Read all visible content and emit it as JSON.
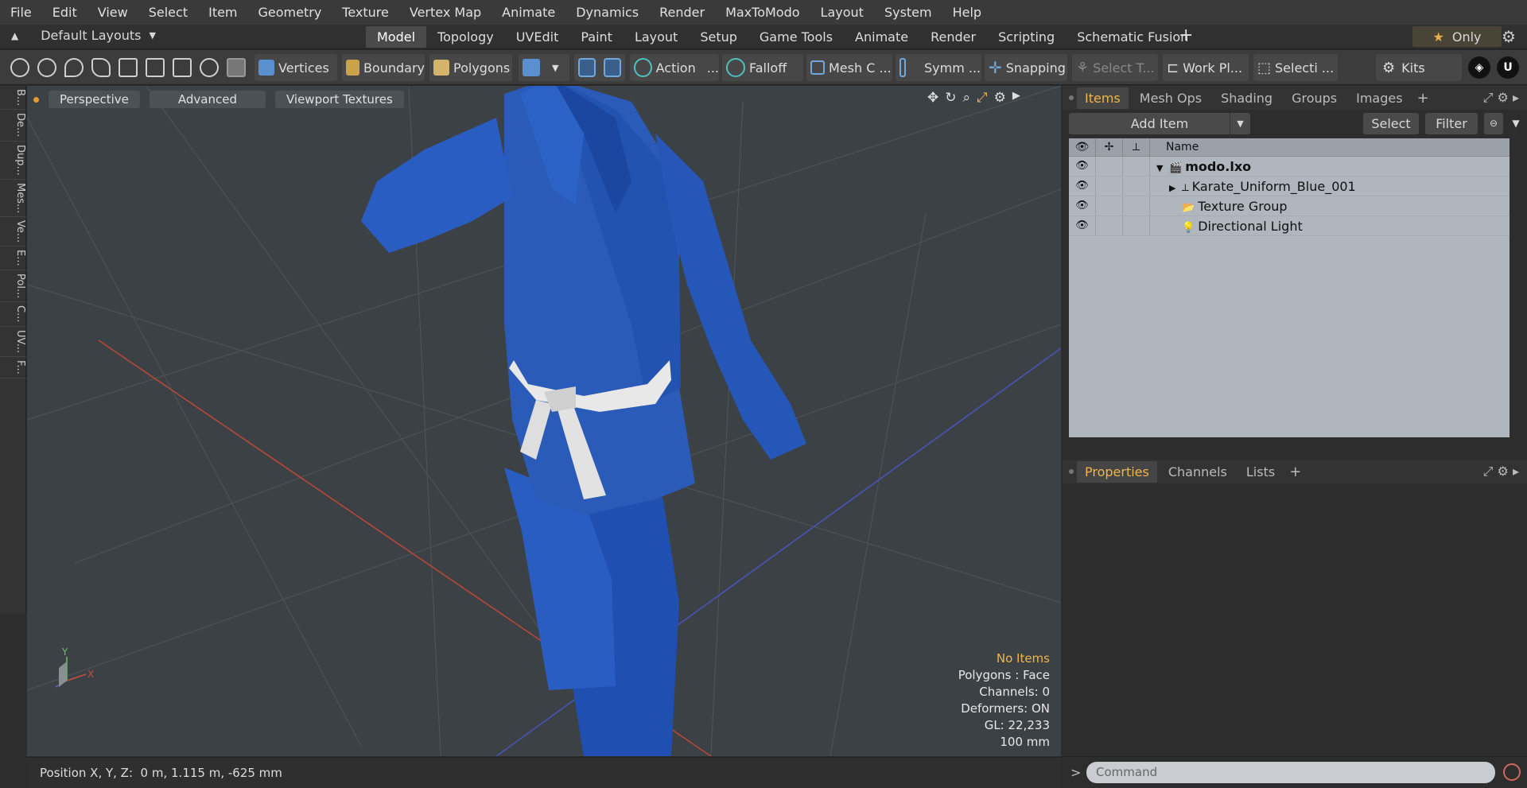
{
  "menu": [
    "File",
    "Edit",
    "View",
    "Select",
    "Item",
    "Geometry",
    "Texture",
    "Vertex Map",
    "Animate",
    "Dynamics",
    "Render",
    "MaxToModo",
    "Layout",
    "System",
    "Help"
  ],
  "layout_selector": "Default Layouts",
  "tabs": [
    "Model",
    "Topology",
    "UVEdit",
    "Paint",
    "Layout",
    "Setup",
    "Game Tools",
    "Animate",
    "Render",
    "Scripting",
    "Schematic Fusion"
  ],
  "active_tab": "Model",
  "only_label": "Only",
  "toolbar": {
    "vertices": "Vertices",
    "boundary": "Boundary",
    "polygons": "Polygons",
    "action": "Action",
    "action_more": "...",
    "falloff": "Falloff",
    "mesh": "Mesh C ...",
    "symmetry": "Symm ...",
    "snapping": "Snapping",
    "select_t": "Select T...",
    "work_plane": "Work Pl...",
    "selection": "Selecti ...",
    "kits": "Kits"
  },
  "left_strip": [
    "B...",
    "De...",
    "Dup...",
    "Mes...",
    "Ve...",
    "E...",
    "Pol...",
    "C...",
    "UV...",
    "F..."
  ],
  "viewport": {
    "perspective": "Perspective",
    "advanced": "Advanced",
    "textures": "Viewport Textures",
    "info": {
      "no_items": "No Items",
      "polygons": "Polygons : Face",
      "channels": "Channels: 0",
      "deformers": "Deformers: ON",
      "gl": "GL: 22,233",
      "scale": "100 mm"
    }
  },
  "status": "Position X, Y, Z:  0 m, 1.115 m, -625 mm",
  "panel_tabs": [
    "Items",
    "Mesh Ops",
    "Shading",
    "Groups",
    "Images"
  ],
  "add_item": "Add Item",
  "select_btn": "Select",
  "filter_btn": "Filter",
  "tree_header": "Name",
  "tree_items": [
    {
      "name": "modo.lxo",
      "bold": true,
      "indent": 0,
      "arrow": "▼",
      "icon": "🎬"
    },
    {
      "name": "Karate_Uniform_Blue_001",
      "bold": false,
      "indent": 1,
      "arrow": "▶",
      "icon": "⟂"
    },
    {
      "name": "Texture Group",
      "bold": false,
      "indent": 1,
      "arrow": "",
      "icon": "📂"
    },
    {
      "name": "Directional Light",
      "bold": false,
      "indent": 1,
      "arrow": "",
      "icon": "💡"
    }
  ],
  "props_tabs": [
    "Properties",
    "Channels",
    "Lists"
  ],
  "command_placeholder": "Command",
  "colors": {
    "accent": "#f0b54b",
    "uniform": "#2a5bb8",
    "belt": "#e8e8e8",
    "viewport": "#3c4145"
  }
}
